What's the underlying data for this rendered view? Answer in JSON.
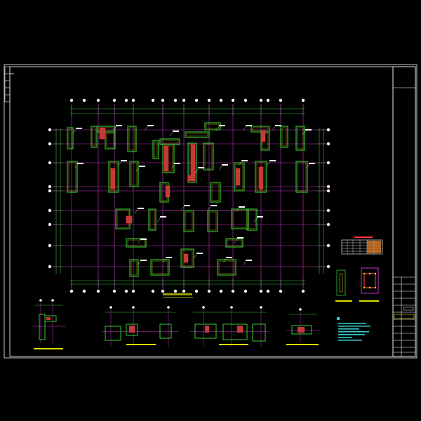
{
  "colors": {
    "background": "#000000",
    "frame": "#ffffff",
    "axis": "#cc33cc",
    "dimension": "#33cc33",
    "wall": "#33cc33",
    "wall_fill": "#c33a3a",
    "highlight": "#ff3333",
    "label_yellow": "#e0e000",
    "label_white": "#ffffff",
    "note_cyan": "#33cccc",
    "title_block": "#ffffff"
  },
  "drawing": {
    "main_plan_title": "",
    "detail_titles": [
      "",
      "",
      "",
      ""
    ],
    "table_title": "",
    "notes_title": ""
  }
}
